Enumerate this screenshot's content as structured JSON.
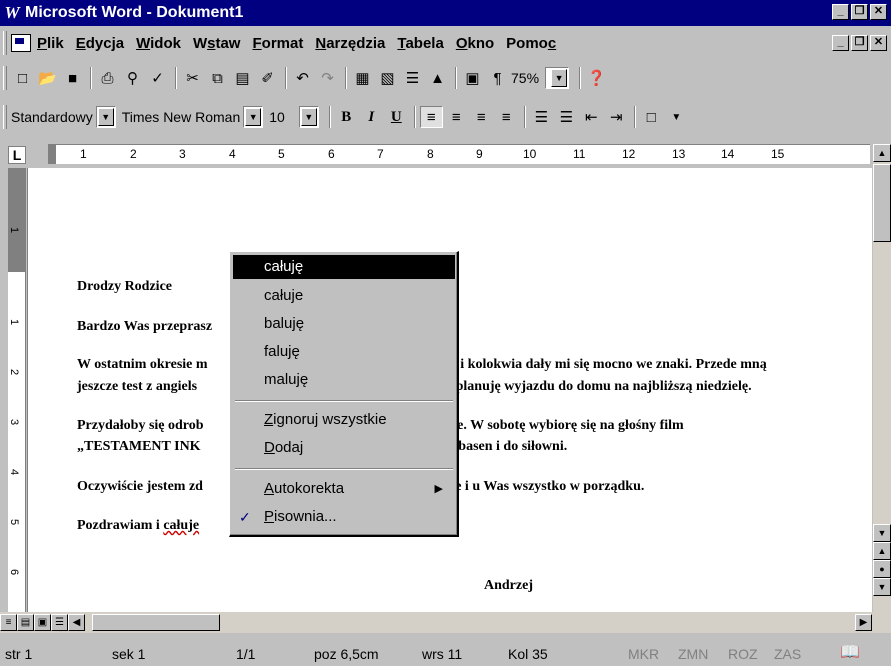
{
  "window": {
    "title": "Microsoft Word - Dokument1",
    "app_icon": "W"
  },
  "window_buttons": [
    "_",
    "❒",
    "✕"
  ],
  "menu": {
    "items": [
      {
        "pre": "",
        "u": "P",
        "post": "lik"
      },
      {
        "pre": "",
        "u": "E",
        "post": "dycja"
      },
      {
        "pre": "",
        "u": "W",
        "post": "idok"
      },
      {
        "pre": "W",
        "u": "s",
        "post": "taw"
      },
      {
        "pre": "",
        "u": "F",
        "post": "ormat"
      },
      {
        "pre": "",
        "u": "N",
        "post": "arzędzia"
      },
      {
        "pre": "",
        "u": "T",
        "post": "abela"
      },
      {
        "pre": "",
        "u": "O",
        "post": "kno"
      },
      {
        "pre": "Pomo",
        "u": "c",
        "post": ""
      }
    ]
  },
  "toolbar_standard": {
    "zoom": "75%",
    "icons": [
      "new-document-icon",
      "open-folder-icon",
      "save-icon",
      "print-icon",
      "print-preview-icon",
      "spelling-icon",
      "cut-icon",
      "copy-icon",
      "paste-icon",
      "format-painter-icon",
      "undo-icon",
      "redo-icon",
      "insert-table-icon",
      "insert-excel-icon",
      "columns-icon",
      "drawing-icon",
      "document-map-icon",
      "show-formatting-icon",
      "help-icon"
    ]
  },
  "toolbar_formatting": {
    "style": "Standardowy",
    "font": "Times New Roman",
    "size": "10",
    "bold_label": "B",
    "italic_label": "I",
    "underline_label": "U"
  },
  "ruler": {
    "tab_selector": "L",
    "marks": [
      "1",
      "2",
      "3",
      "4",
      "5",
      "6",
      "7",
      "8",
      "9",
      "10",
      "11",
      "12",
      "13",
      "14",
      "15"
    ],
    "vertical_marks": [
      "1",
      "1",
      "2",
      "3",
      "4",
      "5",
      "6"
    ]
  },
  "document": {
    "p1": "Drodzy Rodzice",
    "p2": "Bardzo Was przeprasz",
    "p2_tail": ".",
    "p3a": "W ostatnim okresie m",
    "p3a_tail": "ny i kolokwia dały mi się mocno we znaki. Przede mną",
    "p3b": "jeszcze test z angiels",
    "p3b_tail": "ie planuję wyjazdu do domu na najbliższą niedzielę.",
    "p4a": "Przydałoby się odrob",
    "p4a_tail": "owe. W sobotę wybiorę się na głośny film",
    "p4b": "„TESTAMENT INK",
    "p4b_tail": "na basen i do siłowni.",
    "p5": "Oczywiście jestem zd",
    "p5_tail": ", że i u Was wszystko w porządku.",
    "p6": "Pozdrawiam i ",
    "p6_misspelled": "całuje",
    "signature": "Andrzej"
  },
  "context_menu": {
    "suggestions": [
      "całuję",
      "całuje",
      "baluję",
      "faluję",
      "maluję"
    ],
    "ignore_all": {
      "u": "Z",
      "post": "ignoruj wszystkie"
    },
    "add": {
      "u": "D",
      "post": "odaj"
    },
    "autocorrect": {
      "u": "A",
      "post": "utokorekta"
    },
    "spelling": {
      "u": "P",
      "post": "isownia..."
    }
  },
  "status_bar": {
    "page": "str 1",
    "section": "sek 1",
    "pages": "1/1",
    "position": "poz 6,5cm",
    "line": "wrs 11",
    "column": "Kol 35",
    "mkr": "MKR",
    "zmn": "ZMN",
    "roz": "ROZ",
    "zas": "ZAS"
  }
}
